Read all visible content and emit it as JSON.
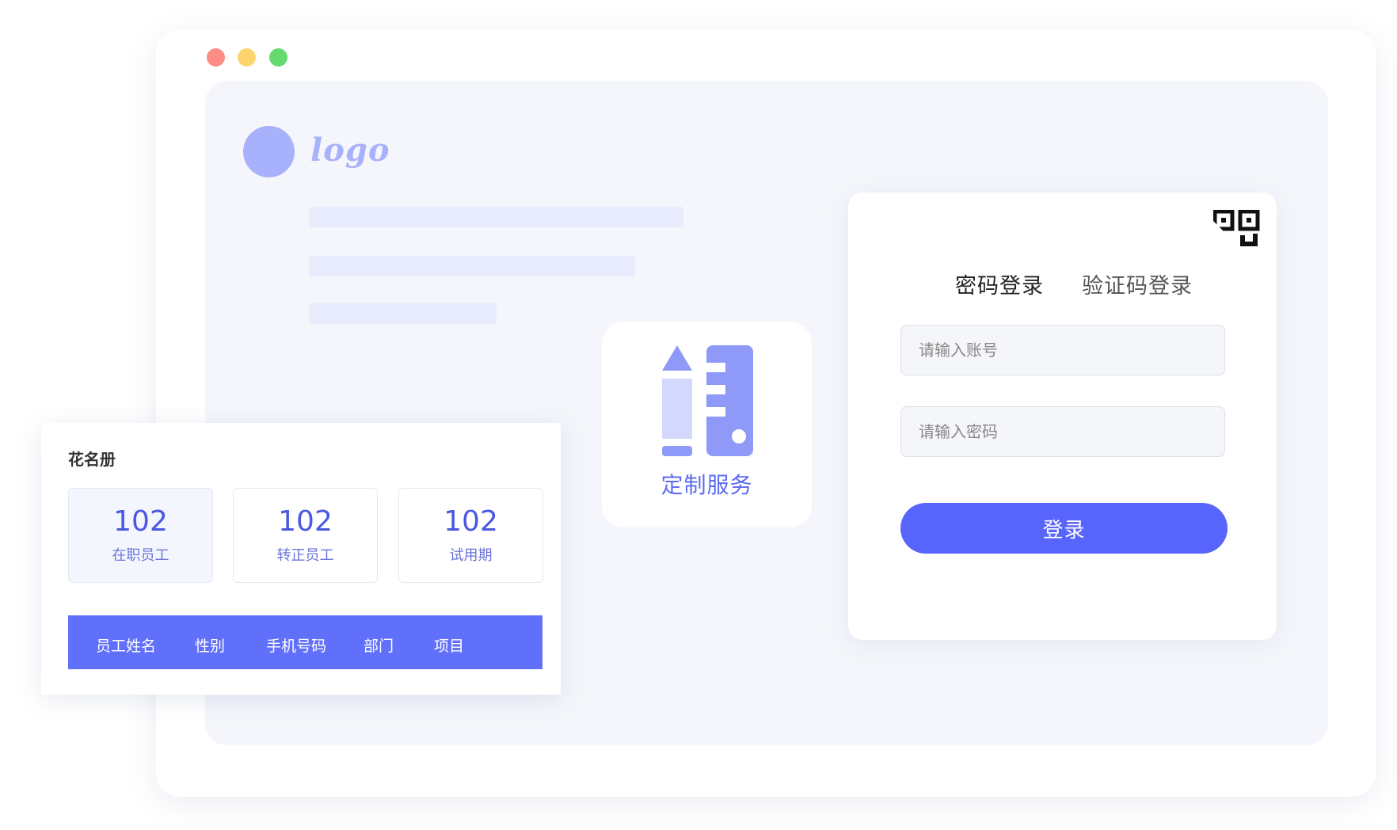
{
  "brand": {
    "logo_text": "logo",
    "logo_color": "#a8b1fb"
  },
  "window": {
    "traffic_lights": [
      "#fe8d86",
      "#fdd56f",
      "#64da6f"
    ]
  },
  "service": {
    "label": "定制服务",
    "icon": "pencil-ruler-icon"
  },
  "roster": {
    "title": "花名册",
    "stats": [
      {
        "value": "102",
        "label": "在职员工"
      },
      {
        "value": "102",
        "label": "转正员工"
      },
      {
        "value": "102",
        "label": "试用期"
      }
    ],
    "columns": [
      "员工姓名",
      "性别",
      "手机号码",
      "部门",
      "项目"
    ]
  },
  "login": {
    "qr_icon": "qr-code-icon",
    "tabs": [
      "密码登录",
      "验证码登录"
    ],
    "account_placeholder": "请输入账号",
    "password_placeholder": "请输入密码",
    "submit_label": "登录",
    "accent_color": "#5865fc"
  }
}
